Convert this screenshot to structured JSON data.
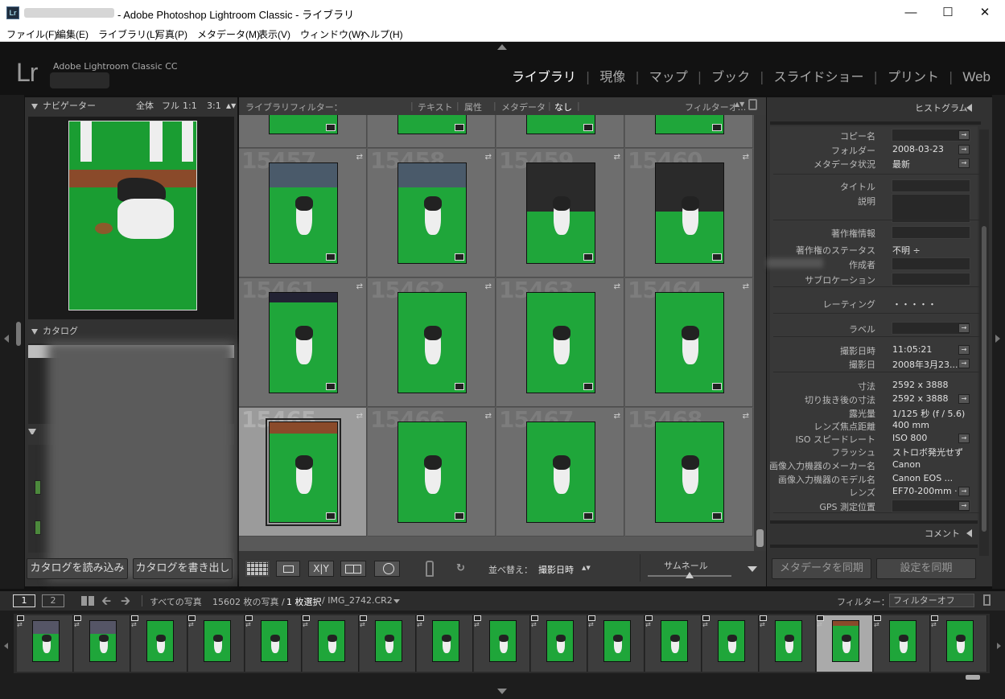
{
  "window": {
    "title": "- Adobe Photoshop Lightroom Classic - ライブラリ",
    "app_icon": "Lr",
    "controls": [
      "minimize-icon",
      "maximize-icon",
      "close-icon"
    ]
  },
  "menu": [
    "ファイル(F)",
    "編集(E)",
    "ライブラリ(L)",
    "写真(P)",
    "メタデータ(M)",
    "表示(V)",
    "ウィンドウ(W)",
    "ヘルプ(H)"
  ],
  "header": {
    "logo": "Lr",
    "product": "Adobe Lightroom Classic CC",
    "modules": [
      "ライブラリ",
      "現像",
      "マップ",
      "ブック",
      "スライドショー",
      "プリント",
      "Web"
    ],
    "active_module": "ライブラリ"
  },
  "navigator": {
    "title": "ナビゲーター",
    "zoom": [
      "全体",
      "フル",
      "1:1",
      "3:1"
    ]
  },
  "catalog": {
    "title": "カタログ",
    "import_button": "カタログを読み込み",
    "export_button": "カタログを書き出し"
  },
  "filterbar": {
    "label": "ライブラリフィルター：",
    "tabs": [
      "テキスト",
      "属性",
      "メタデータ",
      "なし"
    ],
    "active": "なし",
    "preset": "フィルターオ..."
  },
  "grid": {
    "numbers": [
      "15457",
      "15458",
      "15459",
      "15460",
      "15461",
      "15462",
      "15463",
      "15464",
      "15465",
      "15466",
      "15467",
      "15468"
    ],
    "selected_index": 8
  },
  "toolbar": {
    "sort_label": "並べ替え：",
    "sort_value": "撮影日時",
    "thumb_label": "サムネール",
    "thumb_level": 0.5
  },
  "rightpanel": {
    "histogram": "ヒストグラム",
    "comments": "コメント",
    "sync_metadata": "メタデータを同期",
    "sync_settings": "設定を同期",
    "fields": [
      {
        "k": "コピー名",
        "v": ""
      },
      {
        "k": "フォルダー",
        "v": "2008-03-23"
      },
      {
        "k": "メタデータ状況",
        "v": "最新"
      },
      {
        "k": "タイトル",
        "v": ""
      },
      {
        "k": "説明",
        "v": ""
      },
      {
        "k": "著作権情報",
        "v": ""
      },
      {
        "k": "著作権のステータス",
        "v": "不明 ÷"
      },
      {
        "k": "作成者",
        "v": ""
      },
      {
        "k": "サブロケーション",
        "v": ""
      },
      {
        "k": "レーティング",
        "v": "・・・・・"
      },
      {
        "k": "ラベル",
        "v": ""
      },
      {
        "k": "撮影日時",
        "v": "11:05:21"
      },
      {
        "k": "撮影日",
        "v": "2008年3月23..."
      },
      {
        "k": "寸法",
        "v": "2592 x 3888"
      },
      {
        "k": "切り抜き後の寸法",
        "v": "2592 x 3888"
      },
      {
        "k": "露光量",
        "v": "1/125 秒 (f / 5.6)"
      },
      {
        "k": "レンズ焦点距離",
        "v": "400 mm"
      },
      {
        "k": "ISO スピードレート",
        "v": "ISO 800"
      },
      {
        "k": "フラッシュ",
        "v": "ストロボ発光せず"
      },
      {
        "k": "画像入力機器のメーカー名",
        "v": "Canon"
      },
      {
        "k": "画像入力機器のモデル名",
        "v": "Canon EOS ..."
      },
      {
        "k": "レンズ",
        "v": "EF70-200mm ·"
      },
      {
        "k": "GPS 測定位置",
        "v": ""
      }
    ]
  },
  "statusbar": {
    "page1": "1",
    "page2": "2",
    "source": "すべての写真",
    "count": "15602 枚の写真 /",
    "selected": "1 枚選択",
    "filename": "/ IMG_2742.CR2",
    "filter_label": "フィルター：",
    "filter_value": "フィルターオフ"
  }
}
